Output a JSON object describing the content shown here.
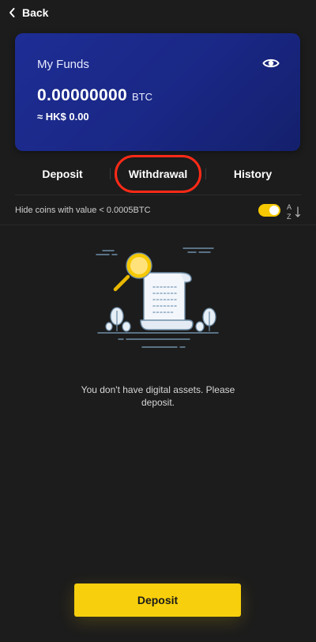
{
  "nav": {
    "back_label": "Back"
  },
  "funds_card": {
    "title": "My Funds",
    "amount": "0.00000000",
    "unit": "BTC",
    "approx_value": "≈ HK$ 0.00"
  },
  "tabs": [
    {
      "label": "Deposit"
    },
    {
      "label": "Withdrawal"
    },
    {
      "label": "History"
    }
  ],
  "filter": {
    "label": "Hide coins with value < 0.0005BTC",
    "toggle_on": true
  },
  "empty_state": {
    "message": "You don't have digital assets. Please deposit."
  },
  "footer": {
    "deposit_button": "Deposit"
  },
  "colors": {
    "accent": "#f7cf0c",
    "card": "#1d2d94",
    "background": "#1c1c1c",
    "highlight": "#ff2a17"
  }
}
